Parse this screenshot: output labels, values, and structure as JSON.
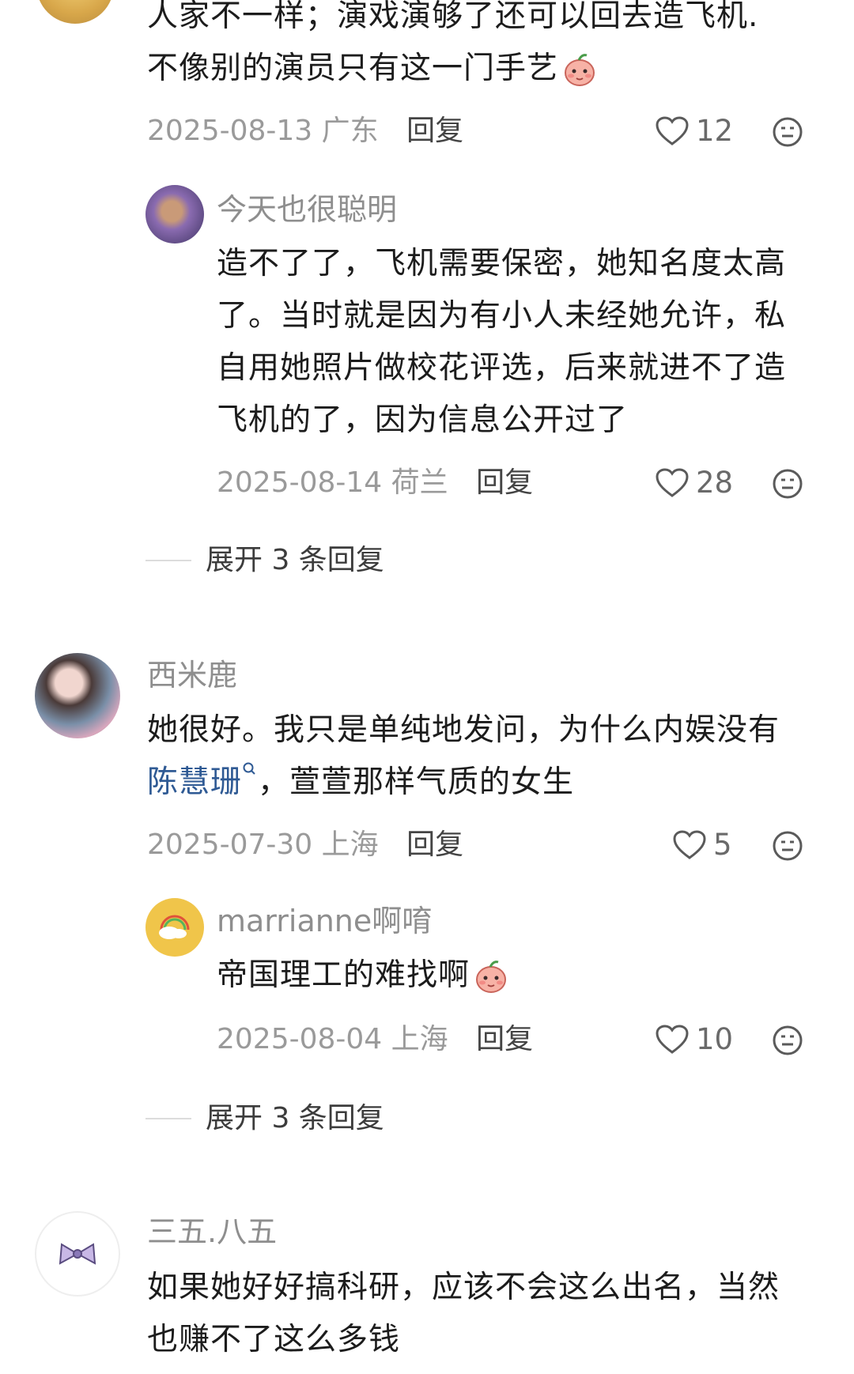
{
  "comments": [
    {
      "id": "c0",
      "lines": [
        "人家不一样；演戏演够了还可以回去造飞机.",
        "不像别的演员只有这一门手艺"
      ],
      "emoji": "peach-blush-emoji",
      "date": "2025-08-13",
      "location": "广东",
      "reply_label": "回复",
      "likes": "12",
      "sub": {
        "name": "今天也很聪明",
        "lines": [
          "造不了了，飞机需要保密，她知名度太高",
          "了。当时就是因为有小人未经她允许，私",
          "自用她照片做校花评选，后来就进不了造",
          "飞机的了，因为信息公开过了"
        ],
        "date": "2025-08-14",
        "location": "荷兰",
        "reply_label": "回复",
        "likes": "28"
      },
      "expand_label": "展开 3 条回复"
    },
    {
      "id": "c1",
      "name": "西米鹿",
      "line1": "她很好。我只是单纯地发问，为什么内娱没有",
      "link_text": "陈慧珊",
      "line2_rest": "，萱萱那样气质的女生",
      "date": "2025-07-30",
      "location": "上海",
      "reply_label": "回复",
      "likes": "5",
      "sub": {
        "name": "marrianne啊唷",
        "line": "帝国理工的难找啊",
        "emoji": "peach-blush-emoji",
        "date": "2025-08-04",
        "location": "上海",
        "reply_label": "回复",
        "likes": "10"
      },
      "expand_label": "展开 3 条回复"
    },
    {
      "id": "c2",
      "name": "三五.八五",
      "lines": [
        "如果她好好搞科研，应该不会这么出名，当然",
        "也赚不了这么多钱"
      ]
    }
  ],
  "icons": {
    "like": "heart-outline-icon",
    "more": "neutral-face-icon",
    "search_link": "search-small-icon"
  },
  "colors": {
    "link": "#2f5a94",
    "meta": "#9a9a9a",
    "name": "#8e8e8e",
    "text": "#1c1c1c"
  }
}
